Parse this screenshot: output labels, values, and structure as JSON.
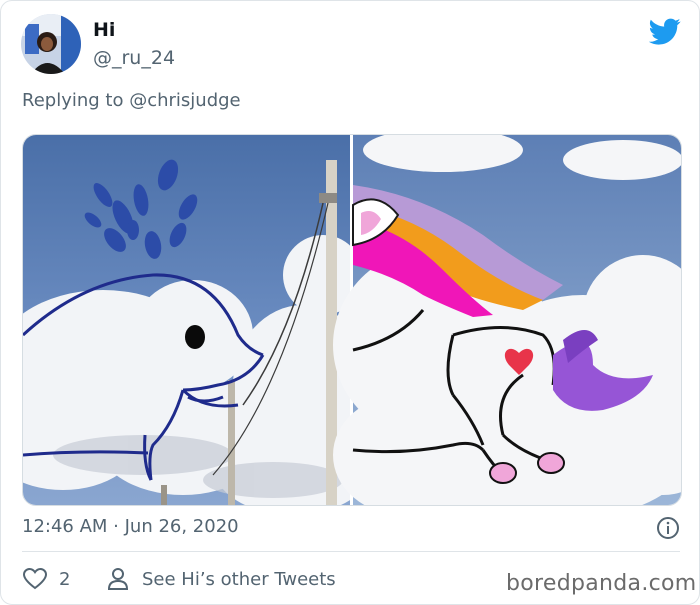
{
  "tweet": {
    "display_name": "Hi",
    "handle": "@_ru_24",
    "replying_to": "Replying to @chrisjudge",
    "timestamp": "12:46 AM · Jun 26, 2020",
    "like_count": "2",
    "other_tweets_link": "See Hi’s other Tweets"
  },
  "icons": {
    "brand": "twitter-bird-icon",
    "info": "info-icon",
    "like": "heart-icon",
    "profile": "person-icon"
  },
  "colors": {
    "twitter_blue": "#1d9bf0",
    "secondary_text": "#536471",
    "heart_red": "#e8344a"
  },
  "watermark": "boredpanda.com"
}
